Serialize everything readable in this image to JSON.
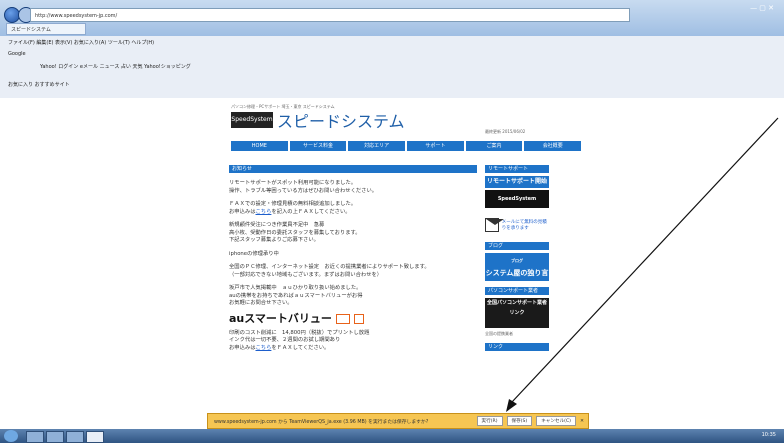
{
  "browser": {
    "address": "http://www.speedsystem-jp.com/",
    "tab_title": "スピードシステム",
    "menu": "ファイル(F)  編集(E)  表示(V)  お気に入り(A)  ツール(T)  ヘルプ(H)",
    "toolbar1": "Google",
    "toolbar2": "Yahoo!  ログイン  eメール  ニュース  占い  天気  Yahoo!ショッピング",
    "favorites": "お気に入り  おすすめサイト"
  },
  "site": {
    "logo_box": "SpeedSystem",
    "logo_text": "スピードシステム",
    "tagline": "パソコン修理・PCサポート 埼玉・東京 スピードシステム",
    "updated": "最終更新 2015/06/02",
    "nav": [
      "HOME",
      "サービス料金",
      "対応エリア",
      "サポート",
      "ご案内",
      "会社概要"
    ]
  },
  "main": {
    "heading": "お知らせ",
    "para1": [
      "リモートサポートがスポット利用可能になりました。",
      "操作、トラブル等困っている方はぜひお問い合わせください。"
    ],
    "para2_line1": "ＦＡＸでの設定・修理見積の無料相談追加しました。",
    "para2_link": "こちら",
    "para2_pre": "お申込みは",
    "para2_post": "を記入の上ＦＡＸしてください。",
    "para3": [
      "新規顧件受注につき作業員不足中　急募",
      "高小枚、受動作日の委託スタッフを募集しております。",
      "下記スタッフ募集よりご応募下さい。"
    ],
    "para4": "iphoneの修理承り中",
    "para5": [
      "全国のＰＣ修理、インターネット設定　お近くの提携業者によりサポート致します。",
      "（一部対応できない地域もございます。まずはお問い合わせを）"
    ],
    "para6": [
      "坂戸市で人気掲載中　ａｕひかり取り扱い始めました。",
      "auの携帯をお持ちであればａｕスマートバリューがお得",
      "お気軽にお問合せ下さい。"
    ],
    "au_title": "auスマートバリュー",
    "para7_1": "印刷のコスト削減に　14,800円（税抜）でプリントし放題",
    "para7_2": "インク代は一切不要、２週間のお試し期間あり",
    "para7_pre": "お申込みは",
    "para7_link": "こちら",
    "para7_post": "をＦＡＸしてください。"
  },
  "side": {
    "h1": "リモートサポート",
    "b1": "リモートサポート開始",
    "b1_logo": "SpeedSystem",
    "mail_text": "メールにて無料の見積りを承ります",
    "h2": "ブログ",
    "blog_label": "ブログ",
    "blog": "システム屋の独り言",
    "h3": "パソコンサポート業者",
    "b3": "全国パソコンサポート業者リンク",
    "note": "全国の提携業者",
    "h4": "リンク"
  },
  "notification": {
    "text": "www.speedsystem-jp.com から TeamViewerQS_ja.exe (3.96 MB) を実行または保存しますか?",
    "run": "実行(R)",
    "save": "保存(S)",
    "cancel": "キャンセル(C)"
  },
  "taskbar": {
    "clock": "10:35"
  }
}
